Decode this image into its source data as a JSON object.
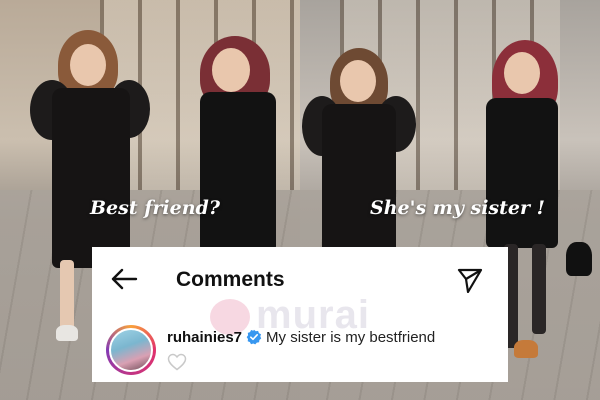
{
  "photos": {
    "left_caption": "Best friend?",
    "right_caption": "She's my sister !"
  },
  "comments": {
    "title": "Comments",
    "back_icon": "arrow-left-icon",
    "send_icon": "send-icon",
    "comment": {
      "username": "ruhainies7",
      "verified_icon": "verified-badge-icon",
      "text": "My sister is my bestfriend",
      "like_icon": "heart-outline-icon"
    }
  },
  "watermark": {
    "text": "murai"
  },
  "colors": {
    "card_background": "#ffffff",
    "verified_blue": "#3797f0",
    "text_primary": "#111111",
    "caption_text": "#ffffff"
  }
}
